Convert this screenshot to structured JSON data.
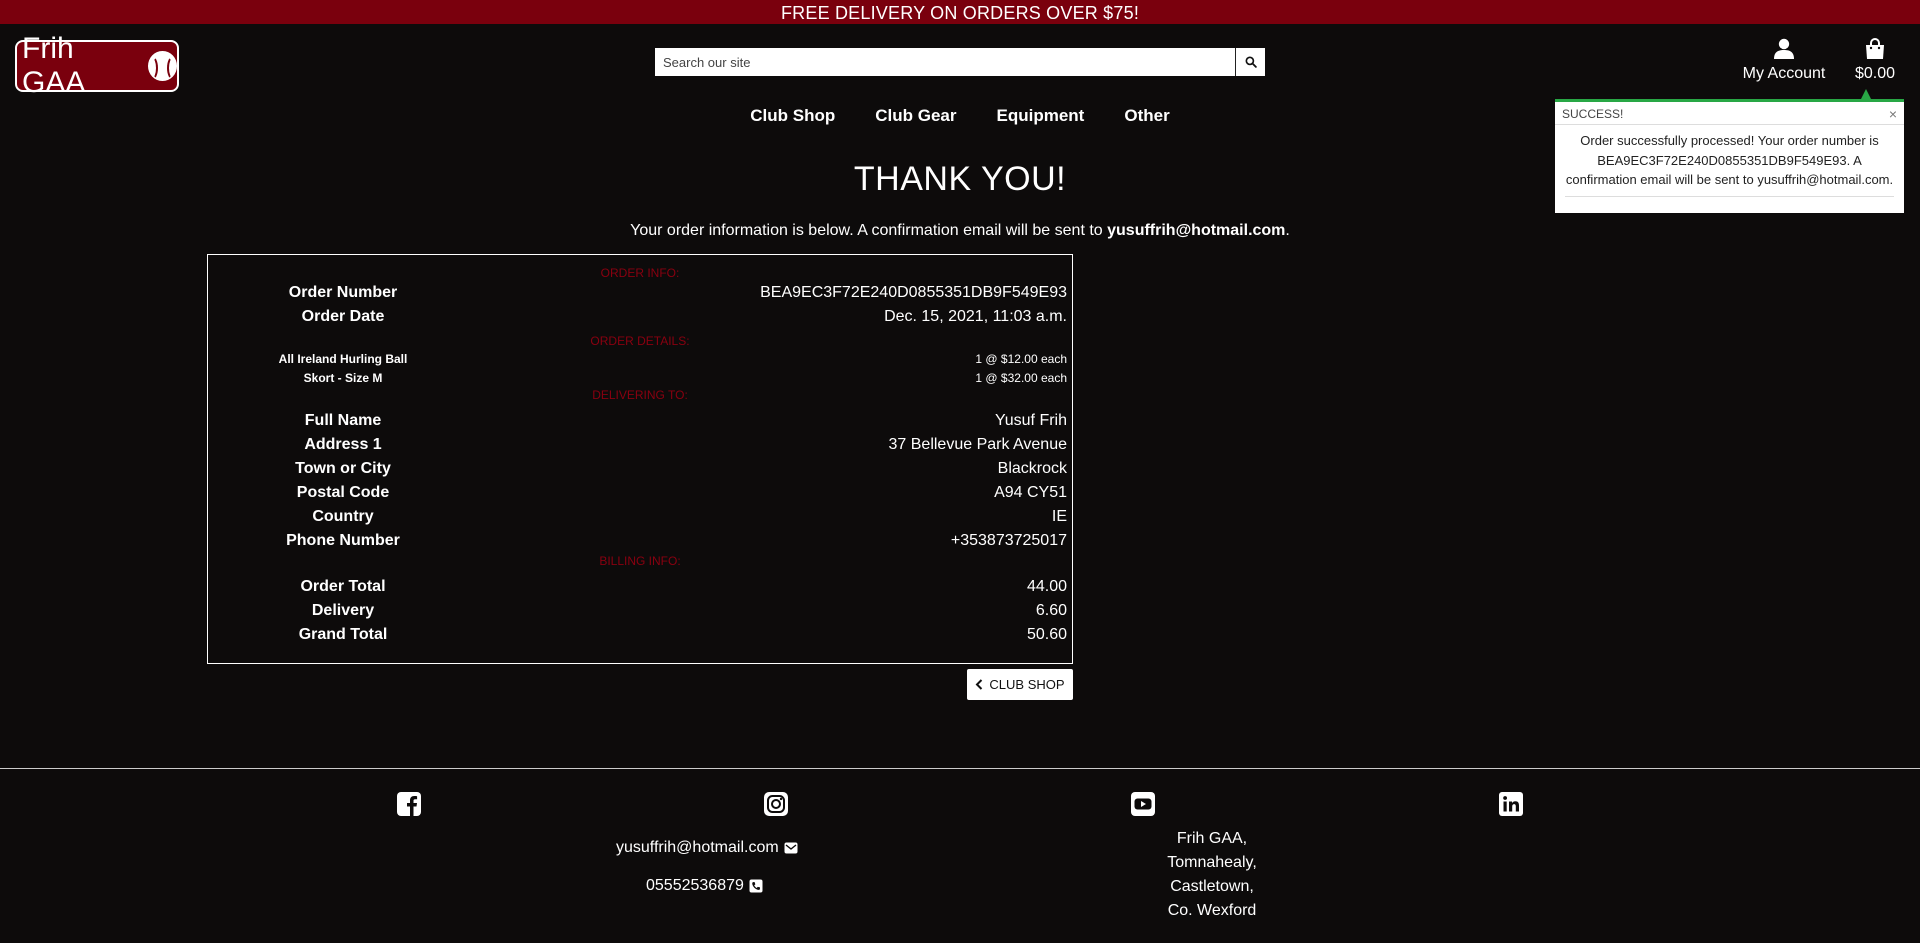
{
  "banner": "FREE DELIVERY ON ORDERS OVER $75!",
  "logo": {
    "text": "Frih GAA",
    "icon": "sliotar-icon"
  },
  "search": {
    "placeholder": "Search our site",
    "icon": "search-icon"
  },
  "account": {
    "label": "My Account",
    "icon": "user-icon"
  },
  "bag": {
    "amount": "$0.00",
    "icon": "shopping-bag-icon"
  },
  "nav": [
    "Club Shop",
    "Club Gear",
    "Equipment",
    "Other"
  ],
  "toast": {
    "title": "SUCCESS!",
    "close": "×",
    "message": "Order successfully processed! Your order number is BEA9EC3F72E240D0855351DB9F549E93. A confirmation email will be sent to yusuffrih@hotmail.com."
  },
  "page": {
    "title": "THANK YOU!",
    "subtitle_prefix": "Your order information is below. A confirmation email will be sent to ",
    "email": "yusuffrih@hotmail.com",
    "subtitle_suffix": "."
  },
  "order": {
    "order_info_heading": "ORDER INFO:",
    "order_number_label": "Order Number",
    "order_number": "BEA9EC3F72E240D0855351DB9F549E93",
    "order_date_label": "Order Date",
    "order_date": "Dec. 15, 2021, 11:03 a.m.",
    "details_heading": "ORDER DETAILS:",
    "items": [
      {
        "name": "All Ireland Hurling Ball",
        "qty": "1 @ $12.00 each"
      },
      {
        "name": "Skort - Size M",
        "qty": "1 @ $32.00 each"
      }
    ],
    "delivery_heading": "DELIVERING TO:",
    "delivery": [
      {
        "label": "Full Name",
        "value": "Yusuf Frih"
      },
      {
        "label": "Address 1",
        "value": "37 Bellevue Park Avenue"
      },
      {
        "label": "Town or City",
        "value": "Blackrock"
      },
      {
        "label": "Postal Code",
        "value": "A94 CY51"
      },
      {
        "label": "Country",
        "value": "IE"
      },
      {
        "label": "Phone Number",
        "value": "+353873725017"
      }
    ],
    "billing_heading": "BILLING INFO:",
    "billing": [
      {
        "label": "Order Total",
        "value": "44.00"
      },
      {
        "label": "Delivery",
        "value": "6.60"
      },
      {
        "label": "Grand Total",
        "value": "50.60"
      }
    ]
  },
  "back_button": {
    "label": "CLUB SHOP",
    "icon": "chevron-left-icon"
  },
  "footer": {
    "social": [
      "facebook-icon",
      "instagram-icon",
      "youtube-icon",
      "linkedin-icon"
    ],
    "email": "yusuffrih@hotmail.com",
    "phone": "05552536879",
    "address": [
      "Frih GAA,",
      "Tomnahealy,",
      "Castletown,",
      "Co. Wexford"
    ]
  },
  "colors": {
    "brand": "#7a000d",
    "background": "#0d0b0b",
    "success": "#28a745"
  }
}
